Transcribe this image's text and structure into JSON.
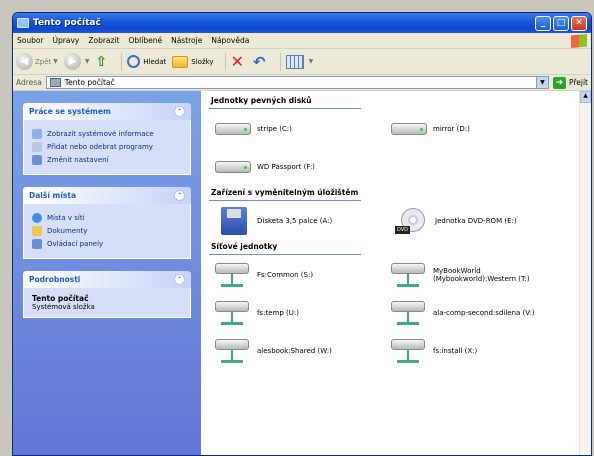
{
  "window": {
    "title": "Tento počítač"
  },
  "menu": [
    "Soubor",
    "Úpravy",
    "Zobrazit",
    "Oblíbené",
    "Nástroje",
    "Nápověda"
  ],
  "toolbar": {
    "back": "Zpět",
    "search": "Hledat",
    "folders": "Složky"
  },
  "address": {
    "label": "Adresa",
    "value": "Tento počítač",
    "go": "Přejít"
  },
  "panels": {
    "system": {
      "title": "Práce se systémem",
      "tasks": [
        "Zobrazit systémové informace",
        "Přidat nebo odebrat programy",
        "Změnit nastavení"
      ]
    },
    "places": {
      "title": "Další místa",
      "tasks": [
        "Místa v síti",
        "Dokumenty",
        "Ovládací panely"
      ]
    },
    "details": {
      "title": "Podrobnosti",
      "name": "Tento počítač",
      "type": "Systémová složka"
    }
  },
  "groups": {
    "hdd": {
      "title": "Jednotky pevných disků",
      "items": [
        "stripe (C:)",
        "mirror (D:)",
        "WD Passport (F:)"
      ]
    },
    "removable": {
      "title": "Zařízení s vyměnitelným úložištěm",
      "items": [
        "Disketa 3,5 palce (A:)",
        "Jednotka DVD-ROM (E:)"
      ],
      "dvd_label": "DVD"
    },
    "network": {
      "title": "Síťové jednotky",
      "items": [
        "Fs:Common (S:)",
        "MyBookWorld (Mybookworld):Western (T:)",
        "fs:temp (U:)",
        "ala-comp-second:sdilena (V:)",
        "alesbook:Shared (W:)",
        "fs:install (X:)"
      ]
    }
  }
}
